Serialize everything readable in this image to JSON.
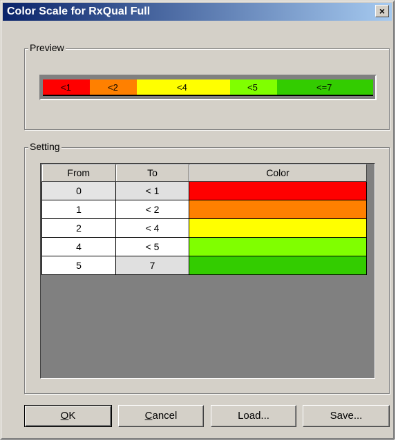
{
  "window": {
    "title": "Color Scale for RxQual Full",
    "close_label": "×"
  },
  "preview": {
    "group_label": "Preview",
    "segments": [
      {
        "label": "<1",
        "color": "#ff0000"
      },
      {
        "label": "<2",
        "color": "#ff8000"
      },
      {
        "label": "<4",
        "color": "#ffff00"
      },
      {
        "label": "<5",
        "color": "#80ff00"
      },
      {
        "label": "<=7",
        "color": "#33cc00"
      }
    ]
  },
  "setting": {
    "group_label": "Setting",
    "columns": [
      "From",
      "To",
      "Color"
    ],
    "rows": [
      {
        "from": "0",
        "to": "< 1",
        "color": "#ff0000"
      },
      {
        "from": "1",
        "to": "< 2",
        "color": "#ff8000"
      },
      {
        "from": "2",
        "to": "< 4",
        "color": "#ffff00"
      },
      {
        "from": "4",
        "to": "< 5",
        "color": "#80ff00"
      },
      {
        "from": "5",
        "to": "7",
        "color": "#33cc00"
      }
    ]
  },
  "buttons": {
    "ok_mnemonic": "O",
    "ok_rest": "K",
    "cancel_mnemonic": "C",
    "cancel_rest": "ancel",
    "load": "Load...",
    "save": "Save..."
  }
}
